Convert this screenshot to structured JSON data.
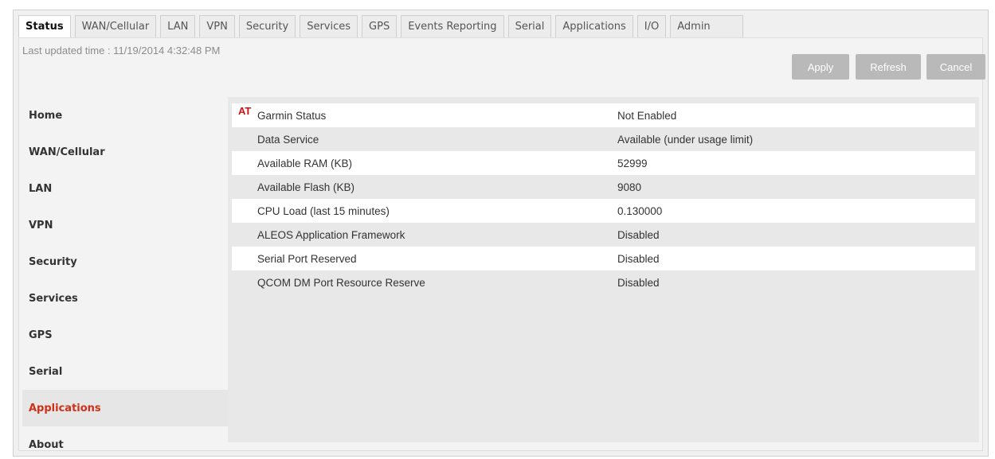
{
  "tabs": [
    {
      "label": "Status",
      "active": true
    },
    {
      "label": "WAN/Cellular"
    },
    {
      "label": "LAN"
    },
    {
      "label": "VPN"
    },
    {
      "label": "Security"
    },
    {
      "label": "Services"
    },
    {
      "label": "GPS"
    },
    {
      "label": "Events Reporting"
    },
    {
      "label": "Serial"
    },
    {
      "label": "Applications"
    },
    {
      "label": "I/O"
    },
    {
      "label": "Admin"
    }
  ],
  "header": {
    "last_updated": "Last updated time : 11/19/2014 4:32:48 PM",
    "apply_label": "Apply",
    "refresh_label": "Refresh",
    "cancel_label": "Cancel"
  },
  "sidebar": {
    "items": [
      {
        "label": "Home"
      },
      {
        "label": "WAN/Cellular"
      },
      {
        "label": "LAN"
      },
      {
        "label": "VPN"
      },
      {
        "label": "Security"
      },
      {
        "label": "Services"
      },
      {
        "label": "GPS"
      },
      {
        "label": "Serial"
      },
      {
        "label": "Applications",
        "active": true
      },
      {
        "label": "About"
      }
    ]
  },
  "table": {
    "at_marker": "AT",
    "rows": [
      {
        "label": "Garmin Status",
        "value": "Not Enabled"
      },
      {
        "label": "Data Service",
        "value": "Available (under usage limit)"
      },
      {
        "label": "Available RAM (KB)",
        "value": "52999"
      },
      {
        "label": "Available Flash (KB)",
        "value": "9080"
      },
      {
        "label": "CPU Load (last 15 minutes)",
        "value": "0.130000"
      },
      {
        "label": "ALEOS Application Framework",
        "value": "Disabled"
      },
      {
        "label": "Serial Port Reserved",
        "value": "Disabled"
      },
      {
        "label": "QCOM DM Port Resource Reserve",
        "value": "Disabled"
      }
    ]
  },
  "colors": {
    "active_sidebar": "#d03018",
    "at_marker": "#d01010",
    "button_bg": "#b9b9b9"
  }
}
